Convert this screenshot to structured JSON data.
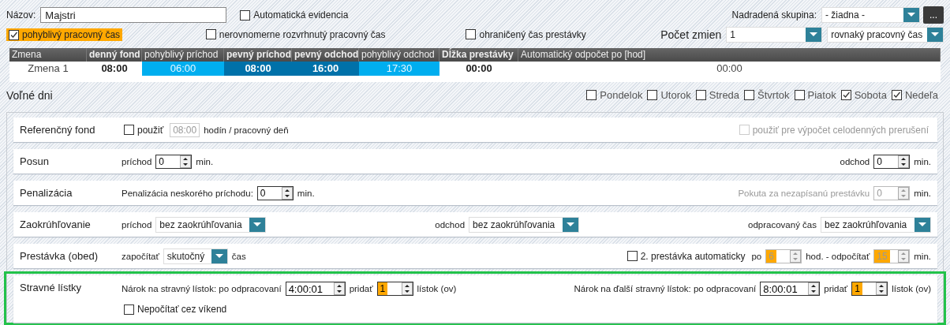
{
  "header": {
    "name_label": "Názov:",
    "name_value": "Majstri",
    "auto_evidence": {
      "label": "Automatická evidencia",
      "checked": false
    },
    "parent_group": {
      "label": "Nadradená skupina:",
      "value": "- žiadna -"
    },
    "more_button": "..."
  },
  "options": [
    {
      "label": "pohyblivý pracovný čas",
      "checked": true
    },
    {
      "label": "nerovnomerne rozvrhnutý pracovný čas",
      "checked": false
    },
    {
      "label": "ohraničený čas prestávky",
      "checked": false
    }
  ],
  "shift_count": {
    "label": "Počet zmien",
    "value": "1"
  },
  "time_mode": {
    "value": "rovnaký pracovný čas"
  },
  "shift_table": {
    "columns": [
      {
        "label": "Zmena",
        "kind": "plain"
      },
      {
        "label": "denný fond",
        "kind": "bold"
      },
      {
        "label": "pohyblivý príchod",
        "kind": "flex"
      },
      {
        "label": "pevný príchod",
        "kind": "fixed"
      },
      {
        "label": "pevný odchod",
        "kind": "fixed"
      },
      {
        "label": "pohyblivý odchod",
        "kind": "flex"
      },
      {
        "label": "Dĺžka prestávky",
        "kind": "bold"
      },
      {
        "label": "Automatický odpočet po [hod]",
        "kind": "plain"
      }
    ],
    "rows": [
      {
        "cells": [
          "Zmena 1",
          "08:00",
          "06:00",
          "08:00",
          "16:00",
          "17:30",
          "00:00",
          "00:00"
        ]
      }
    ]
  },
  "free_days": {
    "label": "Voľné dni",
    "days": [
      {
        "label": "Pondelok",
        "checked": false
      },
      {
        "label": "Utorok",
        "checked": false
      },
      {
        "label": "Streda",
        "checked": false
      },
      {
        "label": "Štvrtok",
        "checked": false
      },
      {
        "label": "Piatok",
        "checked": false
      },
      {
        "label": "Sobota",
        "checked": true
      },
      {
        "label": "Nedeľa",
        "checked": true
      }
    ]
  },
  "sections": [
    {
      "title": "Referenčný fond",
      "outlined": false,
      "lines": [
        {
          "groups": [
            [
              {
                "kind": "checkbox",
                "label": "použiť",
                "checked": false,
                "disabled": false
              },
              {
                "kind": "field",
                "value": "08:00",
                "disabled": true
              },
              {
                "kind": "text",
                "text": "hodín / pracovný deň",
                "disabled": false
              }
            ],
            [
              {
                "kind": "checkbox",
                "label": "použiť pre výpočet celodenných prerušení",
                "checked": false,
                "disabled": true
              }
            ]
          ]
        }
      ]
    },
    {
      "title": "Posun",
      "outlined": false,
      "lines": [
        {
          "groups": [
            [
              {
                "kind": "text",
                "text": "príchod",
                "disabled": false
              },
              {
                "kind": "spin",
                "value": "0",
                "disabled": false,
                "highlighted": false
              },
              {
                "kind": "text",
                "text": "min.",
                "disabled": false
              }
            ],
            [
              {
                "kind": "text",
                "text": "odchod",
                "disabled": false
              },
              {
                "kind": "spin",
                "value": "0",
                "disabled": false,
                "highlighted": false
              },
              {
                "kind": "text",
                "text": "min.",
                "disabled": false
              }
            ]
          ]
        }
      ]
    },
    {
      "title": "Penalizácia",
      "outlined": false,
      "lines": [
        {
          "groups": [
            [
              {
                "kind": "text",
                "text": "Penalizácia neskorého príchodu:",
                "disabled": false
              },
              {
                "kind": "spin",
                "value": "0",
                "disabled": false,
                "highlighted": false
              },
              {
                "kind": "text",
                "text": "min.",
                "disabled": false
              }
            ],
            [
              {
                "kind": "text",
                "text": "Pokuta za nezapísanú prestávku",
                "disabled": true
              },
              {
                "kind": "spin",
                "value": "0",
                "disabled": true,
                "highlighted": false
              },
              {
                "kind": "text",
                "text": "min.",
                "disabled": false
              }
            ]
          ]
        }
      ]
    },
    {
      "title": "Zaokrúhľovanie",
      "outlined": false,
      "lines": [
        {
          "groups": [
            [
              {
                "kind": "text",
                "text": "príchod",
                "disabled": false
              },
              {
                "kind": "dropdown",
                "value": "bez zaokrúhľovania"
              }
            ],
            [
              {
                "kind": "text",
                "text": "odchod",
                "disabled": false
              },
              {
                "kind": "dropdown",
                "value": "bez zaokrúhľovania"
              }
            ],
            [
              {
                "kind": "text",
                "text": "odpracovaný čas",
                "disabled": false
              },
              {
                "kind": "dropdown",
                "value": "bez zaokrúhľovania"
              }
            ]
          ]
        }
      ]
    },
    {
      "title": "Prestávka (obed)",
      "outlined": false,
      "lines": [
        {
          "groups": [
            [
              {
                "kind": "text",
                "text": "započítať",
                "disabled": false
              },
              {
                "kind": "dropdown",
                "value": "skutočný"
              },
              {
                "kind": "text",
                "text": "čas",
                "disabled": false
              }
            ],
            [
              {
                "kind": "checkbox",
                "label": "2. prestávka automaticky",
                "checked": false,
                "disabled": false
              },
              {
                "kind": "text",
                "text": "po",
                "disabled": false
              },
              {
                "kind": "spin",
                "value": "6",
                "disabled": true,
                "highlighted": true
              },
              {
                "kind": "text",
                "text": "hod. - odpočítať",
                "disabled": false
              },
              {
                "kind": "spin",
                "value": "15",
                "disabled": true,
                "highlighted": true
              },
              {
                "kind": "text",
                "text": "min.",
                "disabled": false
              }
            ]
          ]
        }
      ]
    },
    {
      "title": "Stravné lístky",
      "outlined": true,
      "lines": [
        {
          "groups": [
            [
              {
                "kind": "text",
                "text": "Nárok na stravný lístok: po odpracovaní",
                "disabled": false
              },
              {
                "kind": "spin",
                "value": "4:00:01",
                "disabled": false,
                "highlighted": false
              },
              {
                "kind": "text",
                "text": "pridať",
                "disabled": false
              },
              {
                "kind": "spin",
                "value": "1",
                "disabled": false,
                "highlighted": true
              },
              {
                "kind": "text",
                "text": "lístok (ov)",
                "disabled": false
              }
            ],
            [
              {
                "kind": "text",
                "text": "Nárok na ďalší stravný lístok: po odpracovaní",
                "disabled": false
              },
              {
                "kind": "spin",
                "value": "8:00:01",
                "disabled": false,
                "highlighted": false
              },
              {
                "kind": "text",
                "text": "pridať",
                "disabled": false
              },
              {
                "kind": "spin",
                "value": "1",
                "disabled": false,
                "highlighted": true
              },
              {
                "kind": "text",
                "text": "lístok (ov)",
                "disabled": false
              }
            ]
          ]
        },
        {
          "groups": [
            [
              {
                "kind": "checkbox",
                "label": "Nepočítať cez víkend",
                "checked": false,
                "disabled": false
              }
            ]
          ]
        }
      ]
    }
  ]
}
